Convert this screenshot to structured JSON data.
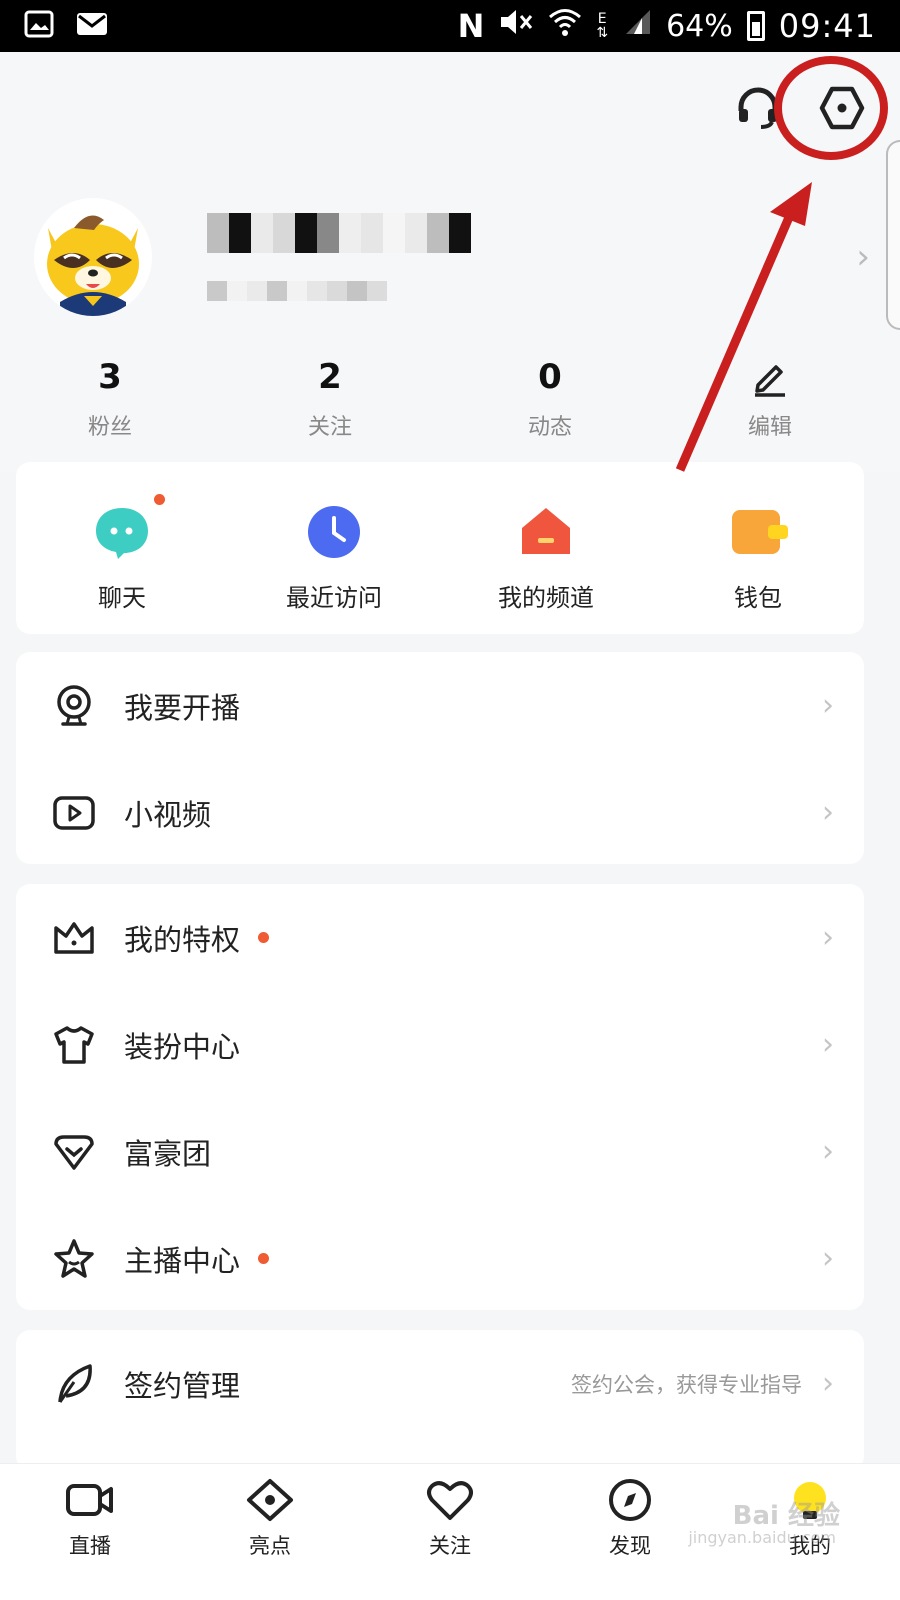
{
  "status_bar": {
    "icons": [
      "gallery-icon",
      "mail-icon",
      "nfc-icon",
      "mute-icon",
      "wifi-icon",
      "data-arrows-icon",
      "signal-icon",
      "battery-icon"
    ],
    "net_label": "N",
    "data_label": "E",
    "battery": "64%",
    "time": "09:41"
  },
  "header": {
    "icons": [
      "headset-icon",
      "settings-icon"
    ],
    "highlight_color": "#c9201f"
  },
  "stats": [
    {
      "value": "3",
      "label": "粉丝"
    },
    {
      "value": "2",
      "label": "关注"
    },
    {
      "value": "0",
      "label": "动态"
    },
    {
      "label": "编辑",
      "icon": "pencil-icon"
    }
  ],
  "quick_actions": [
    {
      "label": "聊天",
      "icon": "chat-icon",
      "badge": true,
      "color": "#3ecdc2"
    },
    {
      "label": "最近访问",
      "icon": "clock-icon",
      "badge": false,
      "color": "#4c6bf0"
    },
    {
      "label": "我的频道",
      "icon": "channel-home-icon",
      "badge": false,
      "color": "#f0563e"
    },
    {
      "label": "钱包",
      "icon": "wallet-icon",
      "badge": false,
      "color": "#f8a53a"
    }
  ],
  "menu_group_1": [
    {
      "label": "我要开播",
      "icon": "webcam-icon"
    },
    {
      "label": "小视频",
      "icon": "video-play-icon"
    }
  ],
  "menu_group_2": [
    {
      "label": "我的特权",
      "icon": "crown-icon",
      "dot": true
    },
    {
      "label": "装扮中心",
      "icon": "tshirt-icon",
      "dot": false
    },
    {
      "label": "富豪团",
      "icon": "diamond-icon",
      "dot": false
    },
    {
      "label": "主播中心",
      "icon": "star-icon",
      "dot": true
    }
  ],
  "menu_group_3": [
    {
      "label": "签约管理",
      "icon": "feather-icon",
      "subtitle": "签约公会，获得专业指导"
    }
  ],
  "tabbar": [
    {
      "label": "直播",
      "icon": "camera-icon"
    },
    {
      "label": "亮点",
      "icon": "eye-icon"
    },
    {
      "label": "关注",
      "icon": "heart-icon"
    },
    {
      "label": "发现",
      "icon": "compass-icon"
    },
    {
      "label": "我的",
      "icon": "profile-bulb-icon",
      "active": true
    }
  ],
  "watermark": {
    "text": "Bai 经验",
    "sub": "jingyan.baidu.com"
  },
  "accent_dot_color": "#ef5b32"
}
